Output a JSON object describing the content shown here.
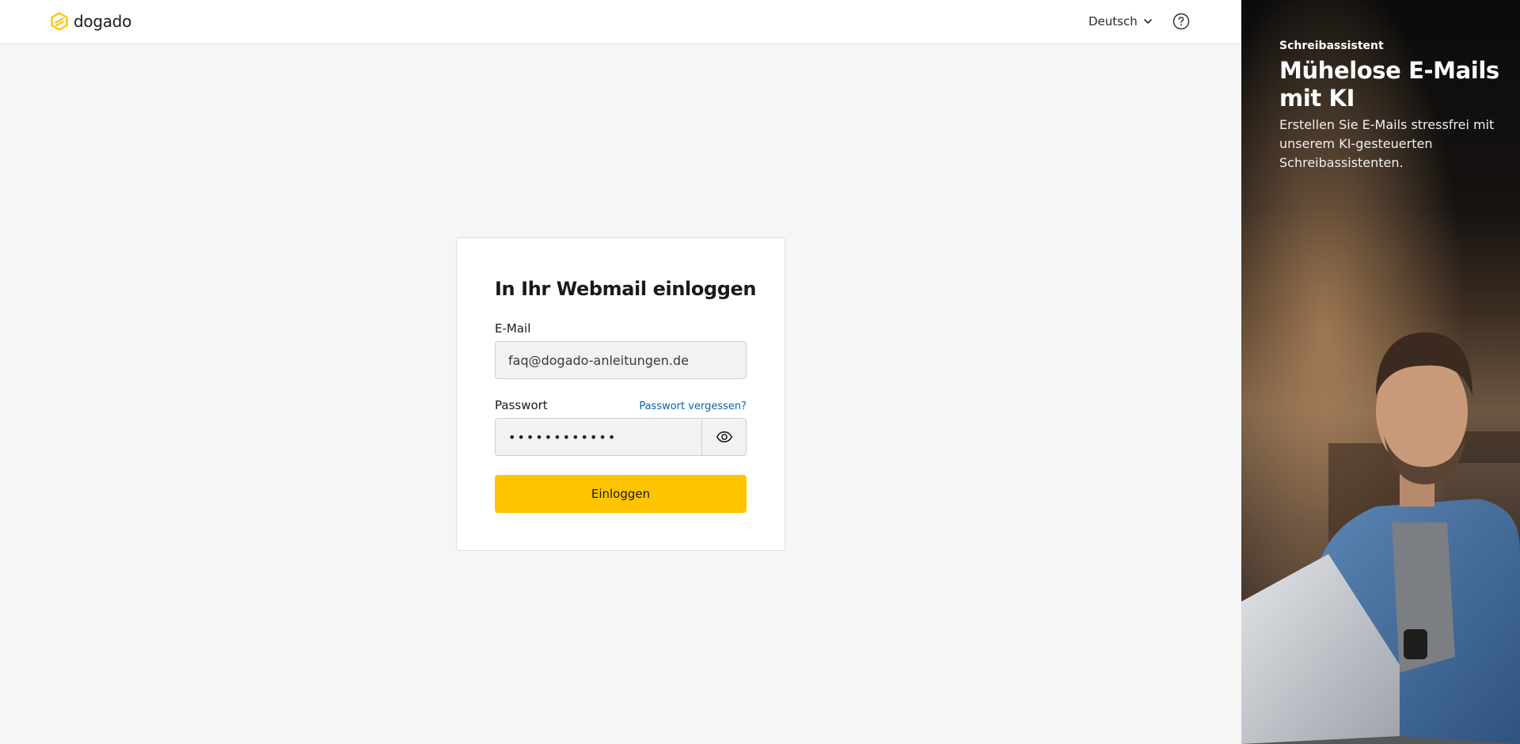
{
  "header": {
    "brand": "dogado",
    "language": "Deutsch"
  },
  "login": {
    "title": "In Ihr Webmail einloggen",
    "email_label": "E-Mail",
    "email_value": "faq@dogado-anleitungen.de",
    "password_label": "Passwort",
    "password_value": "••••••••••••",
    "forgot_link": "Passwort vergessen?",
    "submit_label": "Einloggen"
  },
  "promo": {
    "eyebrow": "Schreibassistent",
    "title": "Mühelose E-Mails mit KI",
    "description": "Erstellen Sie E-Mails stressfrei mit unserem KI-gesteuerten Schreibassistenten."
  },
  "colors": {
    "brand_yellow": "#ffc400",
    "link_blue": "#0a62a8",
    "page_bg": "#f6f6f6",
    "promo_bg": "#0d0d0d"
  },
  "icons": {
    "logo": "dogado-logo-icon",
    "language_dropdown": "chevron-down-icon",
    "help": "help-circle-icon",
    "password_toggle": "eye-icon"
  }
}
